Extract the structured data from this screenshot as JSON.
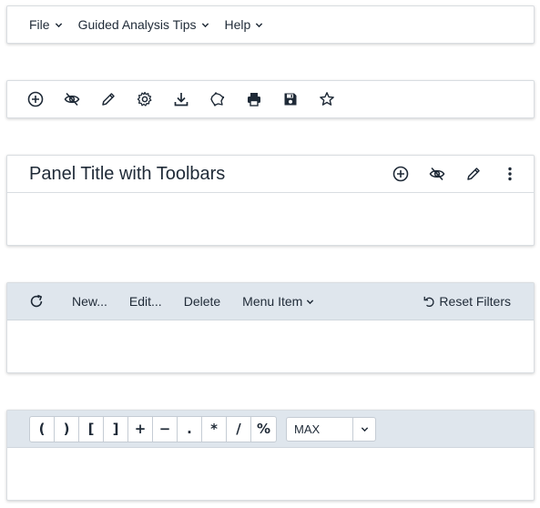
{
  "menubar": {
    "items": [
      {
        "label": "File"
      },
      {
        "label": "Guided Analysis Tips"
      },
      {
        "label": "Help"
      }
    ]
  },
  "icon_toolbar": {
    "icons": [
      "add-circle-icon",
      "hide-eye-icon",
      "edit-pencil-icon",
      "settings-gear-icon",
      "download-icon",
      "region-map-icon",
      "print-icon",
      "save-icon",
      "star-icon"
    ]
  },
  "panel": {
    "title": "Panel Title with Toolbars",
    "tools": [
      "add-circle-icon",
      "hide-eye-icon",
      "edit-pencil-icon",
      "more-vertical-icon"
    ]
  },
  "action_bar": {
    "refresh_icon": "refresh-icon",
    "new_label": "New...",
    "edit_label": "Edit...",
    "delete_label": "Delete",
    "menu_item_label": "Menu Item",
    "reset_label": "Reset Filters",
    "background": "#dfe6ed"
  },
  "calc_bar": {
    "operators": [
      "(",
      ")",
      "[",
      "]",
      "+",
      "−",
      ".",
      "*",
      "/",
      "%"
    ],
    "function_select": "MAX"
  }
}
